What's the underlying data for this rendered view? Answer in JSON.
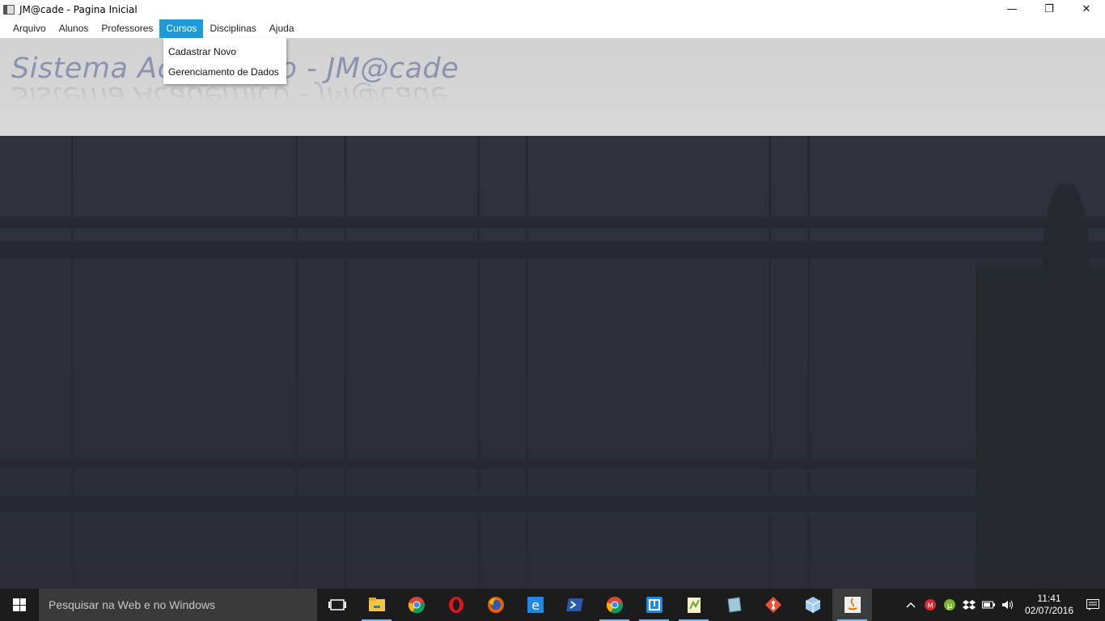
{
  "window": {
    "title": "JM@cade - Pagina Inicial",
    "minimize_glyph": "—",
    "restore_glyph": "❐",
    "close_glyph": "✕"
  },
  "menubar": {
    "items": [
      {
        "label": "Arquivo"
      },
      {
        "label": "Alunos"
      },
      {
        "label": "Professores"
      },
      {
        "label": "Cursos"
      },
      {
        "label": "Disciplinas"
      },
      {
        "label": "Ajuda"
      }
    ],
    "active_index": 3
  },
  "dropdown": {
    "items": [
      {
        "label": "Cadastrar Novo"
      },
      {
        "label": "Gerenciamento de Dados"
      }
    ]
  },
  "banner": {
    "logo_text": "Sistema Academico - JM@cade"
  },
  "taskbar": {
    "search_placeholder": "Pesquisar na Web e no Windows",
    "apps": [
      {
        "icon": "task-view-icon",
        "color": "#ffffff"
      },
      {
        "icon": "file-explorer-icon",
        "color": "#f4c542"
      },
      {
        "icon": "chrome-icon",
        "color": "#4caf50"
      },
      {
        "icon": "opera-icon",
        "color": "#e0141e"
      },
      {
        "icon": "firefox-icon",
        "color": "#e66000"
      },
      {
        "icon": "edge-icon",
        "color": "#1e88e5"
      },
      {
        "icon": "powershell-icon",
        "color": "#2b5aa8"
      },
      {
        "icon": "chrome-icon",
        "color": "#4caf50"
      },
      {
        "icon": "terminal-app-icon",
        "color": "#1e88e5"
      },
      {
        "icon": "notepad-plus-icon",
        "color": "#8bc34a"
      },
      {
        "icon": "virtualbox-icon",
        "color": "#9ec7d9"
      },
      {
        "icon": "git-icon",
        "color": "#f05033"
      },
      {
        "icon": "cube-app-icon",
        "color": "#9ecbf0"
      },
      {
        "icon": "java-icon",
        "color": "#e76f00"
      }
    ],
    "tray": {
      "time": "11:41",
      "date": "02/07/2016"
    }
  },
  "colors": {
    "menu_active": "#1e9bd7",
    "logo": "#8a93b2",
    "taskbar": "#1c1c1c"
  }
}
